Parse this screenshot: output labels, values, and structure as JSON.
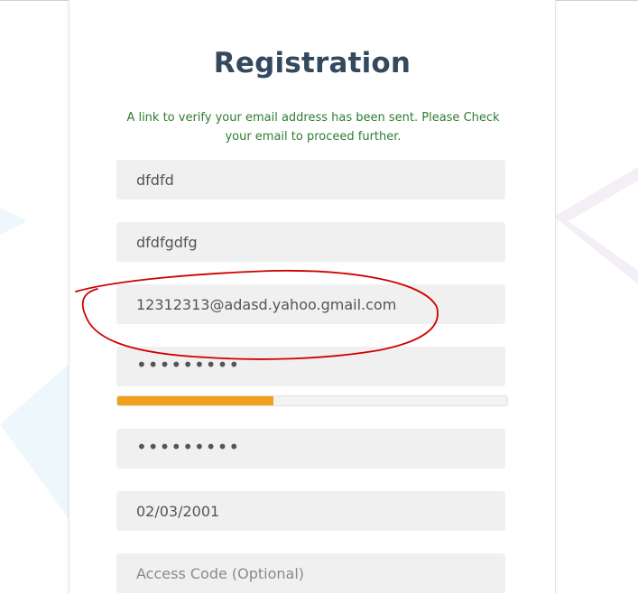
{
  "page": {
    "title": "Registration",
    "notice": "A link to verify your email address has been sent. Please Check your email to proceed further."
  },
  "form": {
    "first_name": "dfdfd",
    "last_name": "dfdfgdfg",
    "email": "12312313@adasd.yahoo.gmail.com",
    "password_masked": "•••••••••",
    "password_strength_percent": 40,
    "confirm_password_masked": "•••••••••",
    "dob": "02/03/2001",
    "access_code_placeholder": "Access Code (Optional)"
  },
  "colors": {
    "title": "#34495e",
    "notice": "#2e7d32",
    "strength_fill": "#f0a01a",
    "annotation": "#d00000"
  }
}
